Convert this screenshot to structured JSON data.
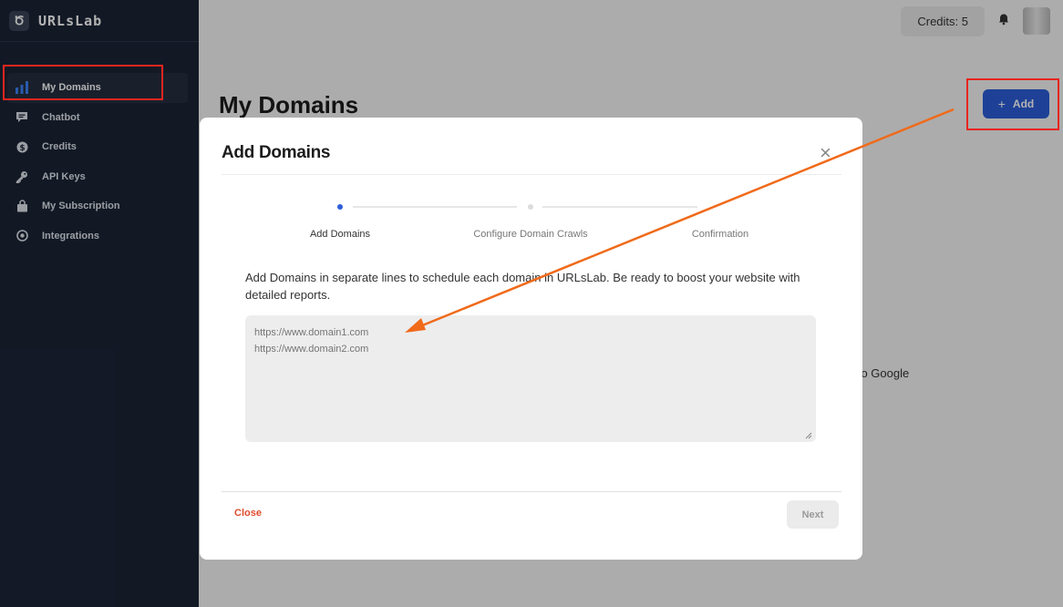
{
  "brand": {
    "name": "URLsLab",
    "logo_glyph": "Ծ"
  },
  "sidebar": {
    "items": [
      {
        "label": "My Domains",
        "icon": "bar-chart-icon"
      },
      {
        "label": "Chatbot",
        "icon": "chat-icon"
      },
      {
        "label": "Credits",
        "icon": "dollar-icon"
      },
      {
        "label": "API Keys",
        "icon": "key-icon"
      },
      {
        "label": "My Subscription",
        "icon": "bag-icon"
      },
      {
        "label": "Integrations",
        "icon": "integrations-icon"
      }
    ],
    "active_index": 0
  },
  "header": {
    "credits": "Credits: 5"
  },
  "page": {
    "title": "My Domains",
    "add_button": "Add",
    "add_icon": "+",
    "background_partial_text": "e to Google"
  },
  "modal": {
    "title": "Add Domains",
    "steps": [
      {
        "label": "Add Domains",
        "state": "active"
      },
      {
        "label": "Configure Domain Crawls",
        "state": "pending"
      },
      {
        "label": "Confirmation",
        "state": "pending"
      }
    ],
    "description": "Add Domains in separate lines to schedule each domain in URLsLab. Be ready to boost your website with detailed reports.",
    "textarea_placeholder": "https://www.domain1.com\nhttps://www.domain2.com",
    "close_label": "Close",
    "next_label": "Next"
  },
  "colors": {
    "sidebar_bg": "#1b2436",
    "accent_blue": "#2c5ed8",
    "annotation_red": "#e8251f",
    "annotation_arrow": "#f06a1a",
    "close_link": "#e04b2e"
  }
}
